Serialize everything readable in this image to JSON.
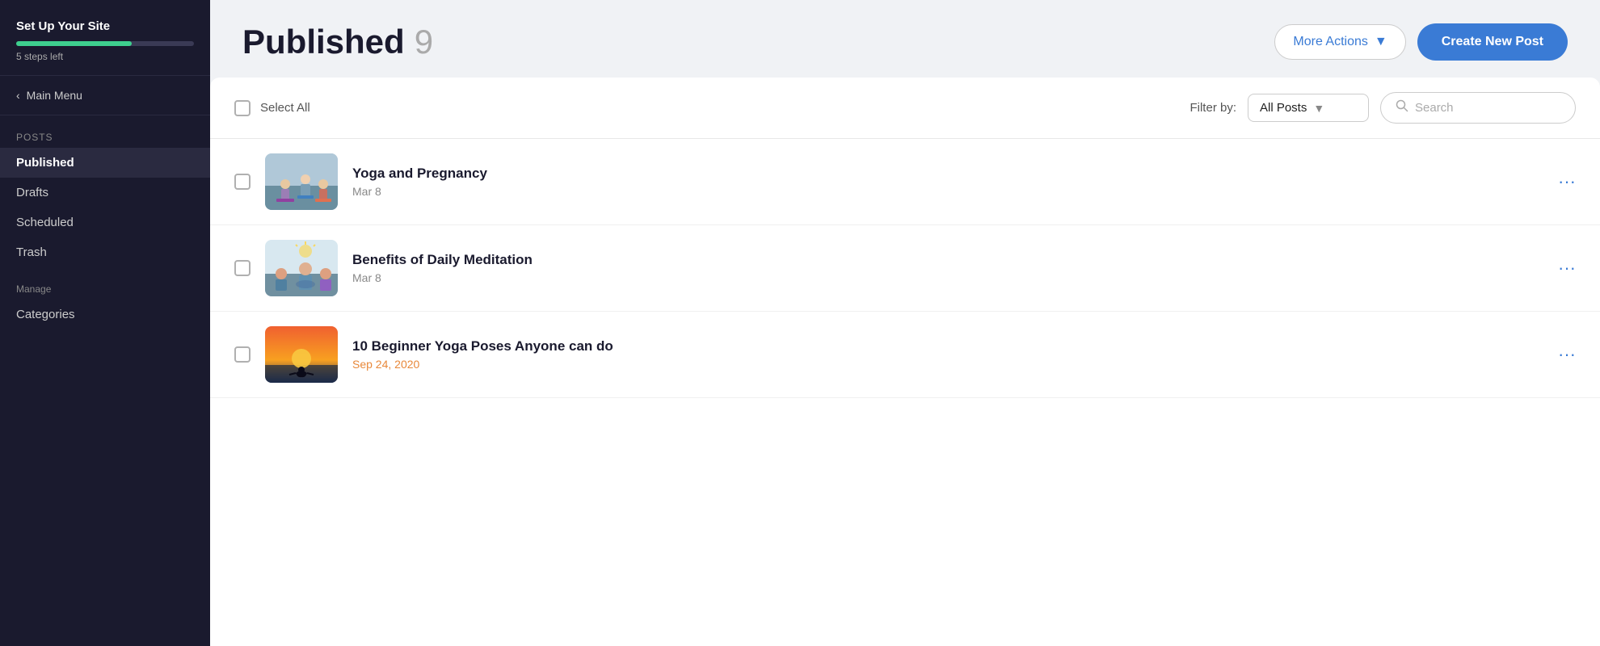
{
  "sidebar": {
    "setup_title": "Set Up Your Site",
    "progress_percent": 65,
    "steps_left": "5 steps left",
    "main_menu_label": "Main Menu",
    "posts_section": "Posts",
    "nav_items": [
      {
        "id": "published",
        "label": "Published",
        "active": true
      },
      {
        "id": "drafts",
        "label": "Drafts",
        "active": false
      },
      {
        "id": "scheduled",
        "label": "Scheduled",
        "active": false
      },
      {
        "id": "trash",
        "label": "Trash",
        "active": false
      }
    ],
    "manage_section": "Manage",
    "manage_items": [
      {
        "id": "categories",
        "label": "Categories"
      }
    ]
  },
  "header": {
    "title": "Published",
    "count": "9",
    "more_actions_label": "More Actions",
    "create_btn_label": "Create New Post"
  },
  "toolbar": {
    "select_all_label": "Select All",
    "filter_label": "Filter by:",
    "filter_value": "All Posts",
    "search_placeholder": "Search"
  },
  "posts": [
    {
      "id": "post-1",
      "title": "Yoga and Pregnancy",
      "date": "Mar 8",
      "date_type": "normal",
      "thumbnail_type": "yoga-pregnancy"
    },
    {
      "id": "post-2",
      "title": "Benefits of Daily Meditation",
      "date": "Mar 8",
      "date_type": "normal",
      "thumbnail_type": "meditation"
    },
    {
      "id": "post-3",
      "title": "10 Beginner Yoga Poses Anyone can do",
      "date": "Sep 24, 2020",
      "date_type": "normal",
      "thumbnail_type": "yoga-poses"
    }
  ],
  "icons": {
    "chevron_down": "▾",
    "chevron_left": "‹",
    "search": "🔍",
    "ellipsis": "···"
  }
}
